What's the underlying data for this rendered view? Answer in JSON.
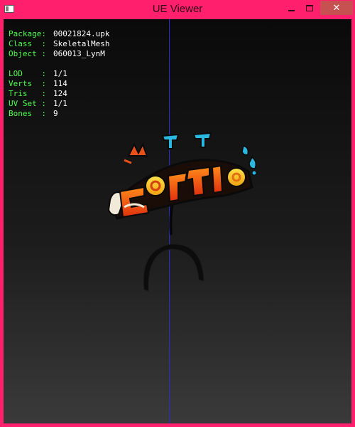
{
  "window": {
    "title": "UE Viewer",
    "close_glyph": "✕"
  },
  "info": {
    "package": {
      "key": "Package:",
      "value": "00021824.upk"
    },
    "class": {
      "key": "Class  :",
      "value": "SkeletalMesh"
    },
    "object": {
      "key": "Object :",
      "value": "060013_LynM"
    },
    "lod": {
      "key": "LOD    :",
      "value": "1/1"
    },
    "verts": {
      "key": "Verts  :",
      "value": "114"
    },
    "tris": {
      "key": "Tris   :",
      "value": "124"
    },
    "uvset": {
      "key": "UV Set :",
      "value": "1/1"
    },
    "bones": {
      "key": "Bones  :",
      "value": "9"
    }
  },
  "colors": {
    "frame": "#ff1f6d",
    "info_text": "#4cff4c",
    "axis": "#2b2bd6"
  }
}
